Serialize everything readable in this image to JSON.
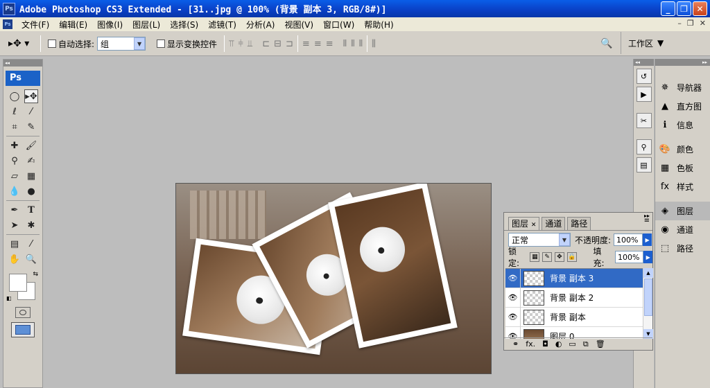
{
  "window": {
    "title": "Adobe Photoshop CS3 Extended - [31..jpg @ 100% (背景 副本 3, RGB/8#)]",
    "app_icon": "Ps"
  },
  "menu": [
    "文件(F)",
    "编辑(E)",
    "图像(I)",
    "图层(L)",
    "选择(S)",
    "滤镜(T)",
    "分析(A)",
    "视图(V)",
    "窗口(W)",
    "帮助(H)"
  ],
  "options": {
    "auto_select_label": "自动选择:",
    "auto_select_value": "组",
    "show_transform_label": "显示变换控件",
    "workspace_label": "工作区"
  },
  "toolbox": {
    "logo": "Ps"
  },
  "right_panel": {
    "group1": [
      "导航器",
      "直方图",
      "信息"
    ],
    "group2": [
      "颜色",
      "色板",
      "样式"
    ],
    "group3": [
      "图层",
      "通道",
      "路径"
    ]
  },
  "layers_panel": {
    "tabs": [
      "图层",
      "通道",
      "路径"
    ],
    "blend_mode": "正常",
    "opacity_label": "不透明度:",
    "opacity_value": "100%",
    "lock_label": "锁定:",
    "fill_label": "填充:",
    "fill_value": "100%",
    "layers": [
      "背景 副本 3",
      "背景 副本 2",
      "背景 副本",
      "图层 0"
    ],
    "footer_fx": "fx."
  }
}
